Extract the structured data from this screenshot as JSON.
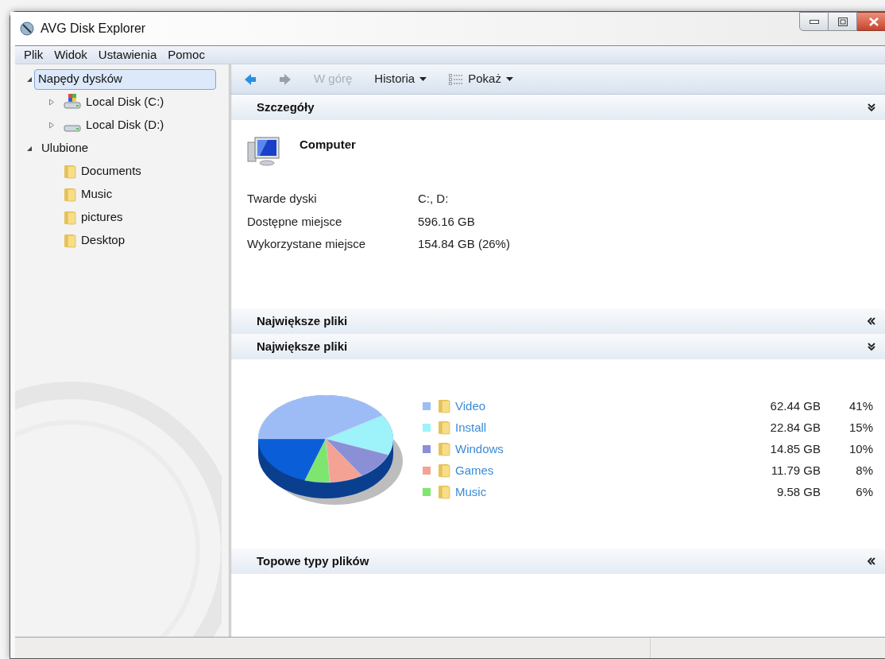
{
  "window": {
    "title": "AVG Disk Explorer"
  },
  "menu": [
    "Plik",
    "Widok",
    "Ustawienia",
    "Pomoc"
  ],
  "tree": [
    {
      "label": "Napędy dysków",
      "expanded": true,
      "selected": true,
      "children": [
        {
          "kind": "system_drive",
          "label": "Local Disk (C:)",
          "expanded": false,
          "selected": false
        },
        {
          "kind": "drive",
          "label": "Local Disk (D:)",
          "expanded": false,
          "selected": false
        }
      ]
    },
    {
      "label": "Ulubione",
      "expanded": true,
      "selected": false,
      "children": [
        {
          "kind": "folder",
          "label": "Documents",
          "selected": false
        },
        {
          "kind": "folder",
          "label": "Music",
          "selected": false
        },
        {
          "kind": "folder",
          "label": "pictures",
          "selected": false
        },
        {
          "kind": "folder",
          "label": "Desktop",
          "selected": false
        }
      ]
    }
  ],
  "toolbar": [
    {
      "kind": "back",
      "disabled": false
    },
    {
      "kind": "forward",
      "disabled": true
    },
    {
      "kind": "text",
      "label": "W górę",
      "disabled": true
    },
    {
      "kind": "dropdown",
      "label": "Historia",
      "disabled": false
    },
    {
      "kind": "view",
      "label": "Pokaż",
      "disabled": false
    }
  ],
  "sections": [
    {
      "kind": "details",
      "title": "Szczegóły",
      "expanded": true,
      "heading": "Computer",
      "rows": [
        {
          "label": "Twarde dyski",
          "value": "C:, D:"
        },
        {
          "label": "Dostępne miejsce",
          "value": "596.16 GB"
        },
        {
          "label": "Wykorzystane miejsce",
          "value": "154.84 GB (26%)"
        }
      ]
    },
    {
      "kind": "collapsed",
      "title": "Największe pliki",
      "expanded": false
    },
    {
      "kind": "largest",
      "title": "Największe pliki",
      "expanded": true,
      "rows": [
        {
          "name": "Video",
          "color": "#9dbcf5",
          "size": "62.44 GB",
          "share": "41%"
        },
        {
          "name": "Install",
          "color": "#9ef2fa",
          "size": "22.84 GB",
          "share": "15%"
        },
        {
          "name": "Windows",
          "color": "#8a8fd6",
          "size": "14.85 GB",
          "share": "10%"
        },
        {
          "name": "Games",
          "color": "#f4a294",
          "size": "11.79 GB",
          "share": "8%"
        },
        {
          "name": "Music",
          "color": "#7ee66f",
          "size": "9.58 GB",
          "share": "6%"
        }
      ]
    },
    {
      "kind": "collapsed",
      "title": "Topowe typy plików",
      "expanded": false
    }
  ]
}
